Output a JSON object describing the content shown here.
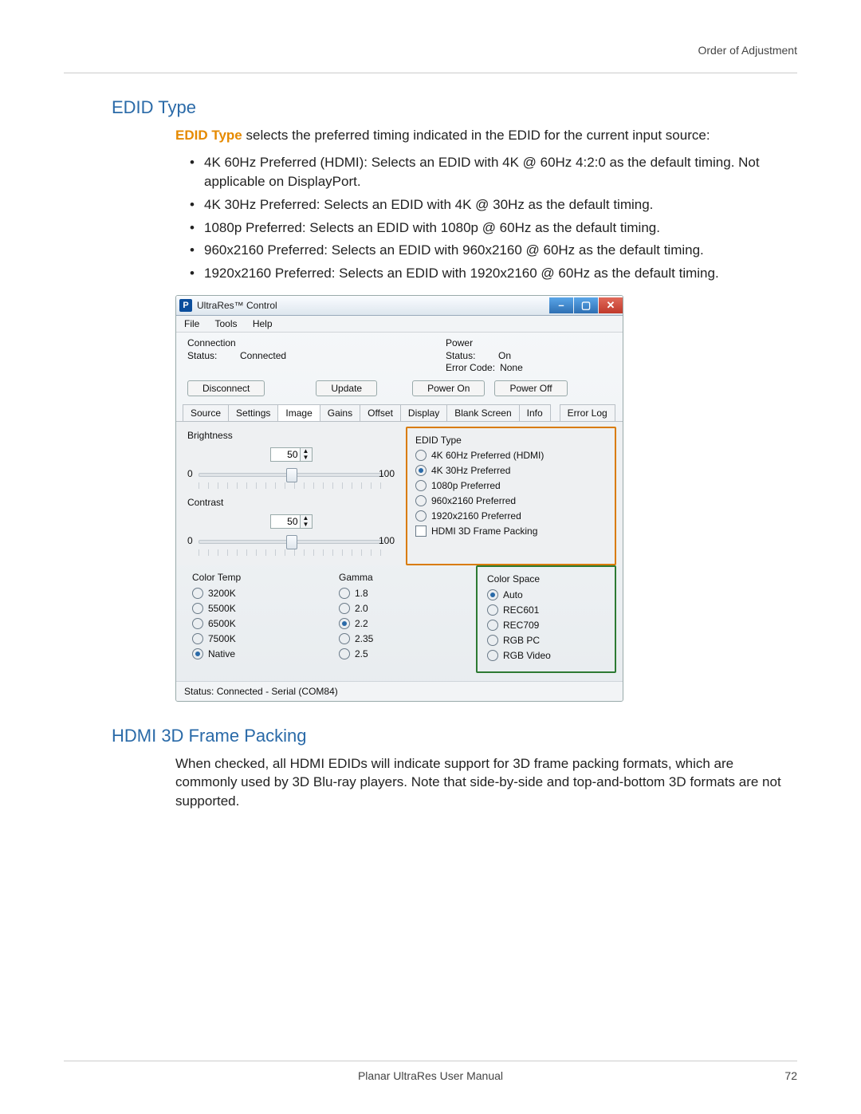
{
  "header_right": "Order of Adjustment",
  "h_edid": "EDID Type",
  "lead_term": "EDID Type",
  "lead_text": " selects the preferred timing indicated in the EDID for the current input source:",
  "bullets": [
    "4K 60Hz Preferred (HDMI): Selects an EDID with 4K @ 60Hz 4:2:0 as the default timing. Not applicable on DisplayPort.",
    "4K 30Hz Preferred: Selects an EDID with 4K @ 30Hz as the default timing.",
    "1080p Preferred: Selects an EDID with 1080p @ 60Hz as the default timing.",
    "960x2160 Preferred: Selects an EDID with 960x2160 @ 60Hz as the default timing.",
    "1920x2160 Preferred: Selects an EDID with 1920x2160 @ 60Hz as the default timing."
  ],
  "win": {
    "icon": "P",
    "title": "UltraRes™ Control",
    "menu": {
      "file": "File",
      "tools": "Tools",
      "help": "Help"
    },
    "conn": {
      "label": "Connection",
      "status_k": "Status:",
      "status_v": "Connected"
    },
    "power": {
      "label": "Power",
      "status_k": "Status:",
      "status_v": "On",
      "err_k": "Error Code:",
      "err_v": "None"
    },
    "btns": {
      "disconnect": "Disconnect",
      "update": "Update",
      "pon": "Power On",
      "poff": "Power Off"
    },
    "tabs": [
      "Source",
      "Settings",
      "Image",
      "Gains",
      "Offset",
      "Display",
      "Blank Screen",
      "Info",
      "Error Log"
    ],
    "active_tab": 2,
    "brightness": {
      "label": "Brightness",
      "val": "50",
      "min": "0",
      "max": "100"
    },
    "contrast": {
      "label": "Contrast",
      "val": "50",
      "min": "0",
      "max": "100"
    },
    "edid": {
      "title": "EDID Type",
      "opts": [
        "4K 60Hz Preferred (HDMI)",
        "4K 30Hz Preferred",
        "1080p Preferred",
        "960x2160 Preferred",
        "1920x2160 Preferred"
      ],
      "selected": 1,
      "chk_label": "HDMI 3D Frame Packing"
    },
    "colortemp": {
      "title": "Color Temp",
      "opts": [
        "3200K",
        "5500K",
        "6500K",
        "7500K",
        "Native"
      ],
      "selected": 4
    },
    "gamma": {
      "title": "Gamma",
      "opts": [
        "1.8",
        "2.0",
        "2.2",
        "2.35",
        "2.5"
      ],
      "selected": 2
    },
    "colorspace": {
      "title": "Color Space",
      "opts": [
        "Auto",
        "REC601",
        "REC709",
        "RGB PC",
        "RGB Video"
      ],
      "selected": 0
    },
    "status": "Status: Connected - Serial (COM84)"
  },
  "h_hdmi": "HDMI 3D Frame Packing",
  "hdmi_text": "When checked, all HDMI EDIDs will indicate support for 3D frame packing formats, which are commonly used by 3D Blu-ray players. Note that side-by-side and top-and-bottom 3D formats are not supported.",
  "footer_center": "Planar UltraRes User Manual",
  "footer_page": "72"
}
